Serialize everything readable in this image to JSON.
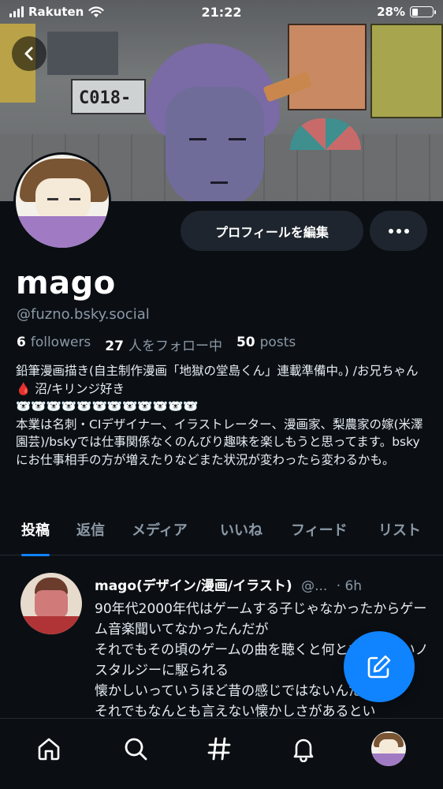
{
  "status_bar": {
    "carrier": "Rakuten",
    "time": "21:22",
    "battery_percent": "28%",
    "battery_level": 0.28
  },
  "banner": {
    "sign_text": "C018-"
  },
  "profile": {
    "display_name": "mago",
    "handle": "@fuzno.bsky.social",
    "edit_label": "プロフィールを編集",
    "followers_count": "6",
    "followers_label": "followers",
    "following_count": "27",
    "following_label": "人をフォロー中",
    "posts_count": "50",
    "posts_label": "posts",
    "bio": "鉛筆漫画描き(自主制作漫画「地獄の堂島くん」連載準備中。) /お兄ちゃん 🩸 沼/キリンジ好き\n🐻‍❄️🐻‍❄️🐻‍❄️🐻‍❄️🐻‍❄️🐻‍❄️🐻‍❄️🐻‍❄️🐻‍❄️🐻‍❄️🐻‍❄️🐻‍❄️\n本業は名刺・CIデザイナー、イラストレーター、漫画家、梨農家の嫁(米澤園芸)/bskyでは仕事関係なくのんびり趣味を楽しもうと思ってます。bskyにお仕事相手の方が増えたりなどまた状況が変わったら変わるかも。"
  },
  "tabs": [
    {
      "label": "投稿",
      "active": true
    },
    {
      "label": "返信",
      "active": false
    },
    {
      "label": "メディア",
      "active": false
    },
    {
      "label": "いいね",
      "active": false
    },
    {
      "label": "フィード",
      "active": false
    },
    {
      "label": "リスト",
      "active": false
    }
  ],
  "post": {
    "author": "mago(デザイン/漫画/イラスト)",
    "handle_truncated": "@...",
    "time": "· 6h",
    "text": "90年代2000年代はゲームする子じゃなかったからゲーム音楽聞いてなかったんだが\nそれでもその頃のゲームの曲を聴くと何とも言えないノスタルジーに駆られる\n懐かしいっていうほど昔の感じではないんだが\nそれでもなんとも言えない懐かしさがあるとい"
  },
  "nav": {
    "items": [
      "home-icon",
      "search-icon",
      "feeds-hash-icon",
      "notifications-bell-icon",
      "profile-avatar"
    ]
  },
  "colors": {
    "accent": "#1083fe",
    "background": "#0b0f14",
    "muted": "#8b98a5"
  }
}
